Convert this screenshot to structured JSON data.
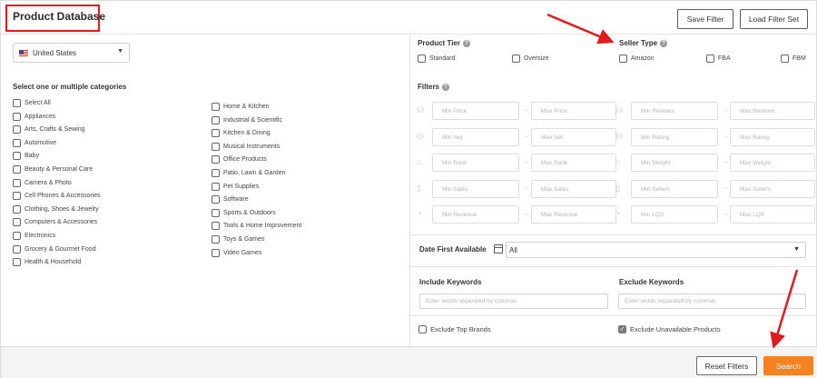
{
  "header": {
    "title": "Product Database",
    "save_filter": "Save Filter",
    "load_filter_set": "Load Filter Set"
  },
  "country": {
    "selected": "United States"
  },
  "categories": {
    "title": "Select one or multiple categories",
    "col1": [
      "Select All",
      "Appliances",
      "Arts, Crafts & Sewing",
      "Automotive",
      "Baby",
      "Beauty & Personal Care",
      "Camera & Photo",
      "Cell Phones & Accessories",
      "Clothing, Shoes & Jewelry",
      "Computers & Accessories",
      "Electronics",
      "Grocery & Gourmet Food",
      "Health & Household"
    ],
    "col2": [
      "Home & Kitchen",
      "Industrial & Scientific",
      "Kitchen & Dining",
      "Musical Instruments",
      "Office Products",
      "Patio, Lawn & Garden",
      "Pet Supplies",
      "Software",
      "Sports & Outdoors",
      "Tools & Home Improvement",
      "Toys & Games",
      "Video Games"
    ]
  },
  "product_tier": {
    "label": "Product Tier",
    "options": [
      "Standard",
      "Oversize"
    ]
  },
  "seller_type": {
    "label": "Seller Type",
    "options": [
      "Amazon",
      "FBA",
      "FBM"
    ]
  },
  "filters": {
    "label": "Filters",
    "left": [
      [
        "Min Price",
        "Max Price"
      ],
      [
        "Min Net",
        "Max Net"
      ],
      [
        "Min Rank",
        "Max Rank"
      ],
      [
        "Min Sales",
        "Max Sales"
      ],
      [
        "Min Revenue",
        "Max Revenue"
      ]
    ],
    "right": [
      [
        "Min Reviews",
        "Max Reviews"
      ],
      [
        "Min Rating",
        "Max Rating"
      ],
      [
        "Min Weight",
        "Max Weight"
      ],
      [
        "Min Sellers",
        "Max Sellers"
      ],
      [
        "Min LQS",
        "Max LQS"
      ]
    ]
  },
  "date_first_available": {
    "label": "Date First Available",
    "value": "All"
  },
  "include_keywords": {
    "label": "Include Keywords",
    "placeholder": "Enter words separated by commas"
  },
  "exclude_keywords": {
    "label": "Exclude Keywords",
    "placeholder": "Enter words separated by commas"
  },
  "exclude_top_brands": {
    "label": "Exclude Top Brands",
    "checked": false
  },
  "exclude_unavailable": {
    "label": "Exclude Unavailable Products",
    "checked": true
  },
  "footer": {
    "reset": "Reset Filters",
    "search": "Search"
  },
  "colors": {
    "accent": "#f58220",
    "annotation": "#e11b1b"
  }
}
